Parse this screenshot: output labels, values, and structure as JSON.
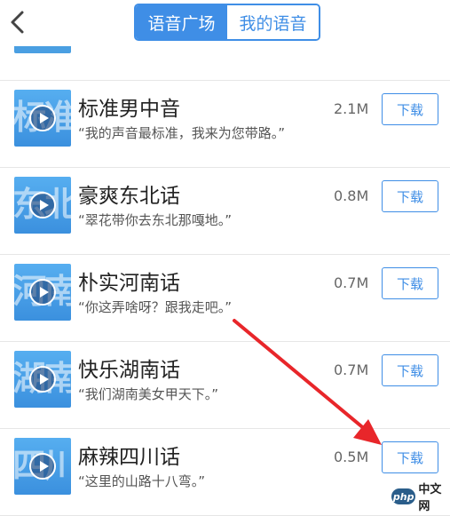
{
  "header": {
    "back_icon": "chevron-left-icon",
    "tabs": [
      {
        "label": "语音广场",
        "active": true
      },
      {
        "label": "我的语音",
        "active": false
      }
    ]
  },
  "items": [
    {
      "thumb_text": "标准",
      "title": "标准男中音",
      "desc": "“我的声音最标准，我来为您带路。”",
      "size": "2.1M",
      "button": "下载"
    },
    {
      "thumb_text": "东北",
      "title": "豪爽东北话",
      "desc": "“翠花带你去东北那嘎地。”",
      "size": "0.8M",
      "button": "下载"
    },
    {
      "thumb_text": "河南",
      "title": "朴实河南话",
      "desc": "“你这弄啥呀？跟我走吧。”",
      "size": "0.7M",
      "button": "下载"
    },
    {
      "thumb_text": "湖南",
      "title": "快乐湖南话",
      "desc": "“我们湖南美女甲天下。”",
      "size": "0.7M",
      "button": "下载"
    },
    {
      "thumb_text": "四川",
      "title": "麻辣四川话",
      "desc": "“这里的山路十八弯。”",
      "size": "0.5M",
      "button": "下载"
    }
  ],
  "annotation": {
    "color": "#e8262a"
  },
  "watermark": {
    "badge": "php",
    "site": "中文网"
  },
  "colors": {
    "accent": "#3f8ee6",
    "thumb": "#4a9fe2"
  }
}
